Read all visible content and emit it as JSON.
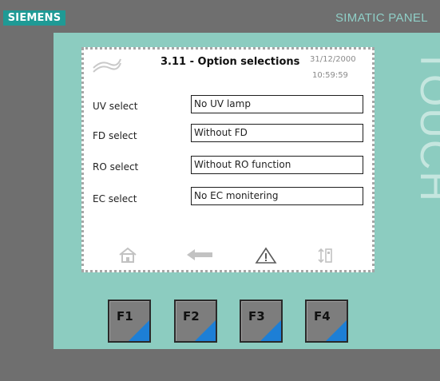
{
  "device": {
    "brand": "SIEMENS",
    "series": "SIMATIC PANEL",
    "touch": "TOUCH"
  },
  "screen": {
    "title": "3.11 - Option selections",
    "date": "31/12/2000",
    "time": "10:59:59",
    "rows": [
      {
        "label": "UV select",
        "value": "No UV lamp"
      },
      {
        "label": "FD select",
        "value": "Without FD"
      },
      {
        "label": "RO select",
        "value": "Without RO function"
      },
      {
        "label": "EC select",
        "value": "No EC monitering"
      }
    ],
    "nav_icons": [
      "home-icon",
      "back-arrow-icon",
      "warning-icon",
      "settings-icon"
    ]
  },
  "function_keys": [
    {
      "label": "F1"
    },
    {
      "label": "F2"
    },
    {
      "label": "F3"
    },
    {
      "label": "F4"
    }
  ],
  "colors": {
    "bezel": "#8cccc0",
    "housing": "#6f6f6f",
    "brand_bg": "#1f9a95",
    "key_accent": "#1d7fd6"
  }
}
